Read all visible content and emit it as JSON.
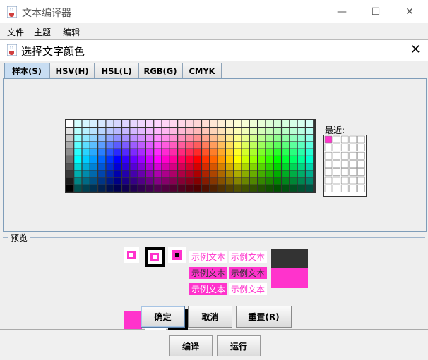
{
  "main_window": {
    "title": "文本编译器",
    "menu": [
      "文件",
      "主题",
      "编辑"
    ],
    "bottom_buttons": [
      "编译",
      "运行"
    ]
  },
  "dialog": {
    "title": "选择文字颜色",
    "tabs": [
      "样本(S)",
      "HSV(H)",
      "HSL(L)",
      "RGB(G)",
      "CMYK"
    ],
    "active_tab": 0,
    "recent_label": "最近:",
    "preview_label": "预览",
    "sample_text": "示例文本",
    "buttons": {
      "ok": "确定",
      "cancel": "取消",
      "reset": "重置(R)"
    },
    "selected_color": "#ff33cc",
    "recent_first_color": "#ff33cc",
    "recent_rows": 7,
    "recent_cols": 5,
    "swatch_rows": 10,
    "swatch_cols": 31
  },
  "icons": [
    "java-cup-icon",
    "minimize-icon",
    "maximize-icon",
    "close-icon"
  ]
}
